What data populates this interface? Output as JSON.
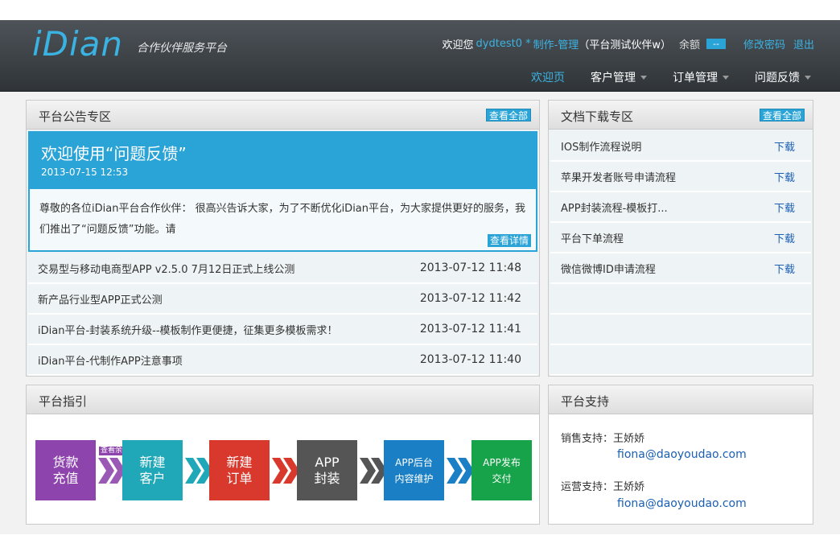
{
  "header": {
    "logo": "iDian",
    "logo_sub": "合作伙伴服务平台",
    "welcome_prefix": "欢迎您",
    "username": "dydtest0 *",
    "role": "制作-管理",
    "org": "（平台测试伙伴w）",
    "balance_label": "余额",
    "balance_value": "--",
    "change_password": "修改密码",
    "logout": "退出"
  },
  "nav": [
    {
      "label": "欢迎页",
      "active": true
    },
    {
      "label": "客户管理"
    },
    {
      "label": "订单管理"
    },
    {
      "label": "问题反馈"
    }
  ],
  "notice": {
    "title": "平台公告专区",
    "view_all": "查看全部",
    "feature": {
      "title": "欢迎使用“问题反馈”",
      "time": "2013-07-15 12:53",
      "body": "尊敬的各位iDian平台合作伙伴： 很高兴告诉大家，为了不断优化iDian平台，为大家提供更好的服务，我们推出了“问题反馈”功能。请",
      "detail": "查看详情"
    },
    "items": [
      {
        "title": "交易型与移动电商型APP v2.5.0 7月12日正式上线公测",
        "date": "2013-07-12 11:48"
      },
      {
        "title": "新产品行业型APP正式公测",
        "date": "2013-07-12 11:42"
      },
      {
        "title": "iDian平台-封装系统升级--模板制作更便捷，征集更多模板需求！",
        "date": "2013-07-12 11:41"
      },
      {
        "title": "iDian平台-代制作APP注意事项",
        "date": "2013-07-12 11:40"
      }
    ]
  },
  "docs": {
    "title": "文档下载专区",
    "view_all": "查看全部",
    "items": [
      {
        "title": "IOS制作流程说明",
        "action": "下载"
      },
      {
        "title": "苹果开发者账号申请流程",
        "action": "下载"
      },
      {
        "title": "APP封装流程-模板打...",
        "action": "下载"
      },
      {
        "title": "平台下单流程",
        "action": "下载"
      },
      {
        "title": "微信微博ID申请流程",
        "action": "下载"
      }
    ]
  },
  "guide": {
    "title": "平台指引",
    "tag": "查看余额",
    "steps": [
      {
        "l1": "货款",
        "l2": "充值",
        "color": "#8e44ad"
      },
      {
        "l1": "新建",
        "l2": "客户",
        "color": "#20a8b8"
      },
      {
        "l1": "新建",
        "l2": "订单",
        "color": "#d9382c"
      },
      {
        "l1": "APP",
        "l2": "封装",
        "color": "#555555"
      },
      {
        "l1": "APP后台",
        "l2": "内容维护",
        "color": "#1a7fc4"
      },
      {
        "l1": "APP发布",
        "l2": "交付",
        "color": "#17a34a"
      }
    ]
  },
  "support": {
    "title": "平台支持",
    "sales_label": "销售支持：王娇娇",
    "sales_email": "fiona@daoyoudao.com",
    "ops_label": "运营支持：王娇娇",
    "ops_email": "fiona@daoyoudao.com"
  }
}
